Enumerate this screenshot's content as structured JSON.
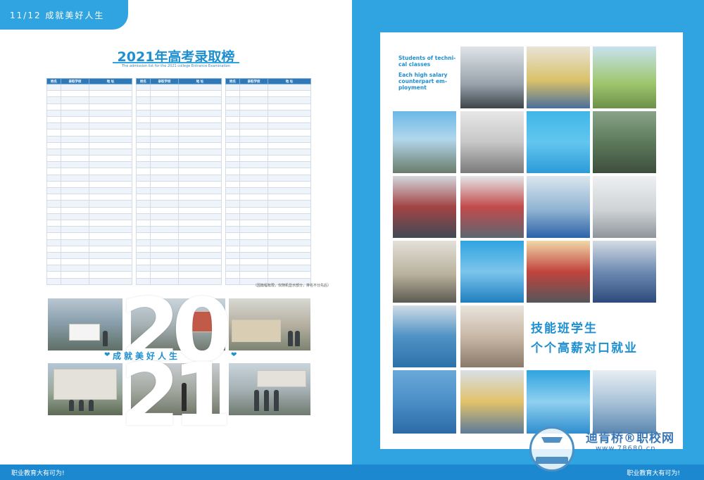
{
  "left": {
    "tab_label": "11/12 成就美好人生",
    "title": "2021年高考录取榜",
    "subtitle": "The admission list for the 2021 college Entrance Examination",
    "headers": [
      "姓名",
      "录取学校",
      "地 址"
    ],
    "note": "（因篇幅有限，仅随机显示部分，排名不分先后）",
    "big_year": [
      "2",
      "0",
      "2",
      "1"
    ],
    "slogan": "成就美好人生",
    "footer": "职业教育大有可为!"
  },
  "right": {
    "english": [
      "Students of techni-",
      "cal classes",
      "Each high salary",
      "counterpart em-",
      "ployment"
    ],
    "slogan_line1": "技能班学生",
    "slogan_line2": "个个高薪对口就业",
    "footer": "职业教育大有可为!",
    "watermark_name": "迪肯桥®职校网",
    "watermark_url": "www.78680.cn"
  },
  "colors": {
    "accent": "#2fa4e0",
    "footer": "#1c88cf",
    "header": "#2f79b9"
  }
}
